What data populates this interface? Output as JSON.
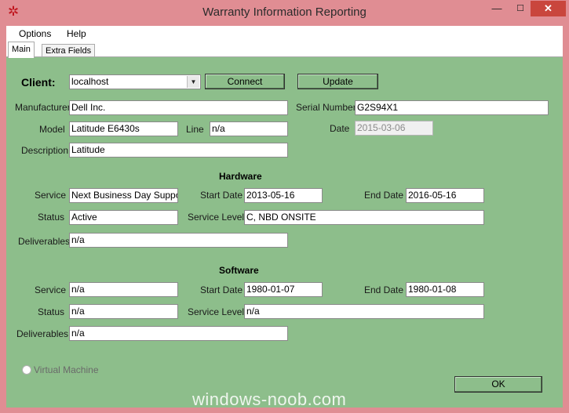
{
  "window": {
    "title": "Warranty Information Reporting",
    "min_glyph": "—",
    "max_glyph": "☐",
    "close_glyph": "✕",
    "icon_glyph": "✲"
  },
  "menu": [
    "Options",
    "Help"
  ],
  "tabs": [
    "Main",
    "Extra Fields"
  ],
  "client": {
    "label": "Client:",
    "value": "localhost",
    "connect": "Connect",
    "update": "Update"
  },
  "info": {
    "manufacturer_label": "Manufacturer",
    "manufacturer": "Dell Inc.",
    "serial_label": "Serial Number",
    "serial": "G2S94X1",
    "model_label": "Model",
    "model": "Latitude E6430s",
    "line_label": "Line",
    "line": "n/a",
    "date_label": "Date",
    "date": "2015-03-06",
    "description_label": "Description",
    "description": "Latitude"
  },
  "hardware": {
    "title": "Hardware",
    "service_label": "Service",
    "service": "Next Business Day Support",
    "start_label": "Start Date",
    "start": "2013-05-16",
    "end_label": "End Date",
    "end": "2016-05-16",
    "status_label": "Status",
    "status": "Active",
    "level_label": "Service Level",
    "level": "C, NBD ONSITE",
    "deliverables_label": "Deliverables",
    "deliverables": "n/a"
  },
  "software": {
    "title": "Software",
    "service_label": "Service",
    "service": "n/a",
    "start_label": "Start Date",
    "start": "1980-01-07",
    "end_label": "End Date",
    "end": "1980-01-08",
    "status_label": "Status",
    "status": "n/a",
    "level_label": "Service Level",
    "level": "n/a",
    "deliverables_label": "Deliverables",
    "deliverables": "n/a"
  },
  "vm_label": "Virtual Machine",
  "ok_label": "OK",
  "watermark": "windows-noob.com"
}
